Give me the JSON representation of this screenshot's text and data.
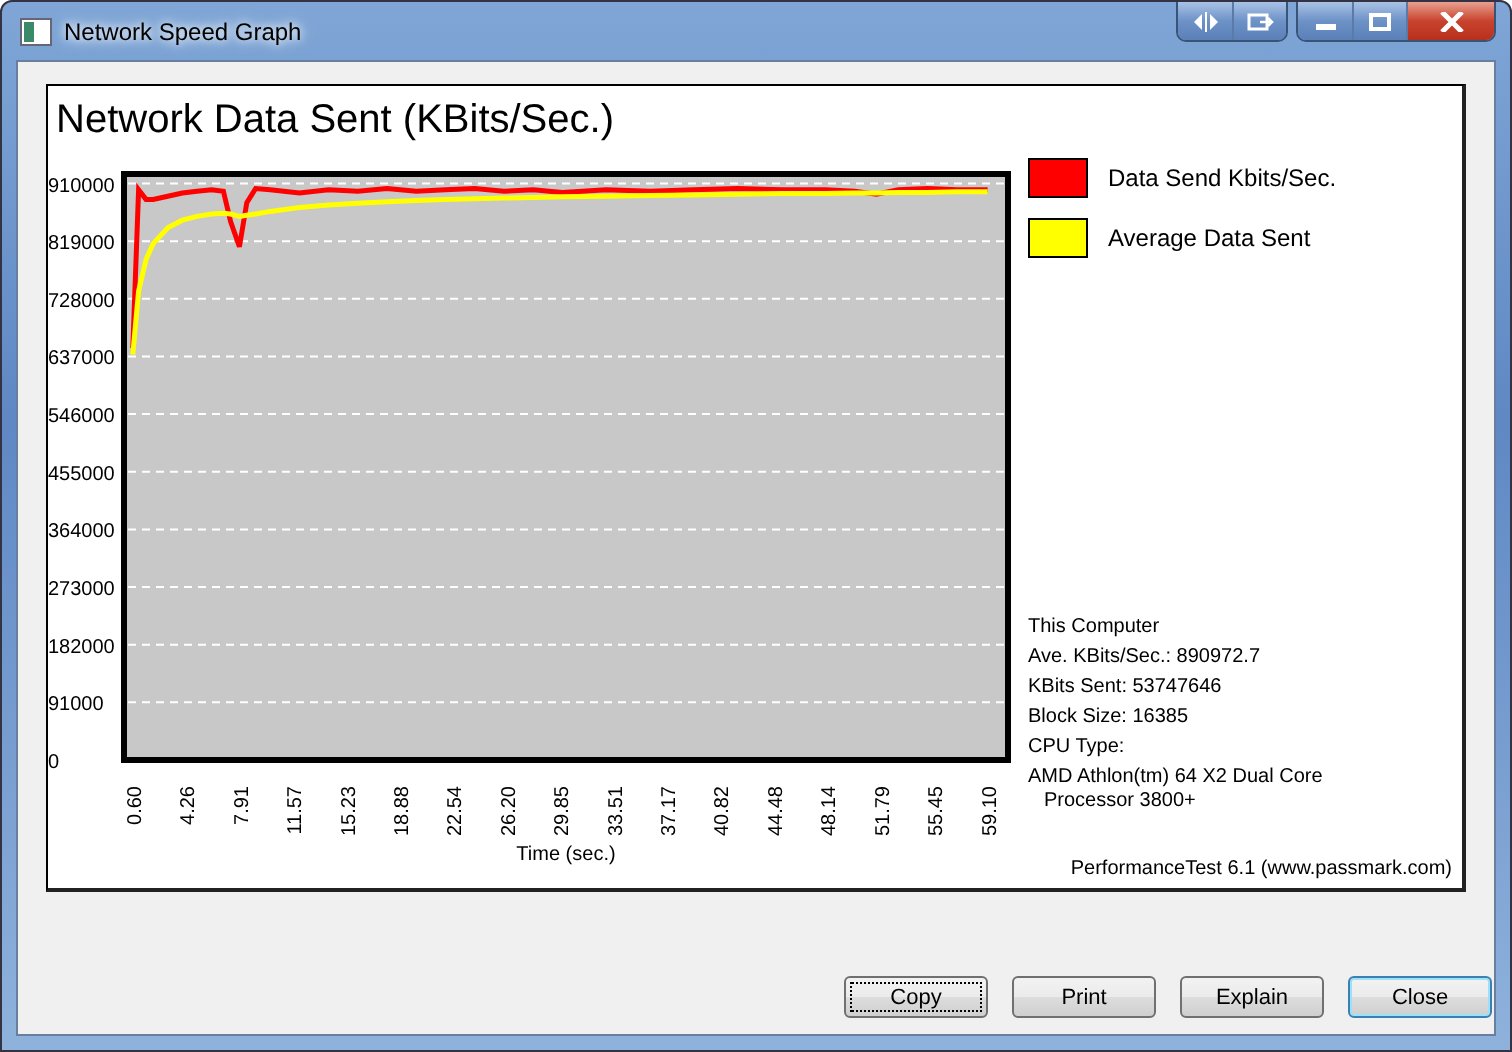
{
  "window": {
    "title": "Network Speed Graph"
  },
  "graph": {
    "title": "Network Data Sent (KBits/Sec.)",
    "chart_data": {
      "type": "line",
      "xlabel": "Time (sec.)",
      "xlim": [
        0,
        60.5
      ],
      "ylim": [
        0,
        925000
      ],
      "grid": true,
      "xticks": [
        {
          "value": 0.6,
          "label": "0.60"
        },
        {
          "value": 4.26,
          "label": "4.26"
        },
        {
          "value": 7.91,
          "label": "7.91"
        },
        {
          "value": 11.57,
          "label": "11.57"
        },
        {
          "value": 15.23,
          "label": "15.23"
        },
        {
          "value": 18.88,
          "label": "18.88"
        },
        {
          "value": 22.54,
          "label": "22.54"
        },
        {
          "value": 26.2,
          "label": "26.20"
        },
        {
          "value": 29.85,
          "label": "29.85"
        },
        {
          "value": 33.51,
          "label": "33.51"
        },
        {
          "value": 37.17,
          "label": "37.17"
        },
        {
          "value": 40.82,
          "label": "40.82"
        },
        {
          "value": 44.48,
          "label": "44.48"
        },
        {
          "value": 48.14,
          "label": "48.14"
        },
        {
          "value": 51.79,
          "label": "51.79"
        },
        {
          "value": 55.45,
          "label": "55.45"
        },
        {
          "value": 59.1,
          "label": "59.10"
        }
      ],
      "yticks": [
        0,
        91000,
        182000,
        273000,
        364000,
        455000,
        546000,
        637000,
        728000,
        819000,
        910000
      ],
      "x": [
        0.6,
        1.0,
        1.5,
        2,
        3,
        4,
        5,
        6,
        6.8,
        7.3,
        7.9,
        8.4,
        9,
        10,
        12,
        14,
        16,
        18,
        20,
        22,
        24,
        26,
        28,
        30,
        33,
        36,
        39,
        42,
        45,
        48,
        50,
        51.5,
        53,
        55,
        57,
        59.1
      ],
      "series": [
        {
          "name": "Data Send Kbits/Sec.",
          "color": "#ff0000",
          "values": [
            650000,
            900000,
            885000,
            885000,
            890000,
            895000,
            898000,
            900000,
            898000,
            850000,
            810000,
            880000,
            902000,
            900000,
            895000,
            900000,
            898000,
            902000,
            898000,
            900000,
            902000,
            898000,
            900000,
            896000,
            900000,
            898000,
            900000,
            902000,
            900000,
            900000,
            898000,
            893000,
            900000,
            902000,
            900000,
            900000
          ]
        },
        {
          "name": "Average Data Sent",
          "color": "#ffff00",
          "values": [
            640000,
            740000,
            790000,
            815000,
            840000,
            852000,
            858000,
            862000,
            863000,
            862000,
            858000,
            860000,
            862000,
            866000,
            872000,
            876000,
            879000,
            881000,
            883000,
            885000,
            886000,
            887000,
            888000,
            889000,
            890000,
            891000,
            892000,
            893000,
            894000,
            894000,
            895000,
            895000,
            896000,
            896000,
            897000,
            897000
          ]
        }
      ]
    }
  },
  "info": {
    "heading": "This Computer",
    "lines": [
      "Ave. KBits/Sec.: 890972.7",
      "KBits Sent: 53747646",
      "Block Size: 16385",
      "CPU Type:"
    ],
    "cpu_lines": [
      "AMD Athlon(tm) 64 X2 Dual Core",
      "Processor 3800+"
    ]
  },
  "footer": "PerformanceTest 6.1 (www.passmark.com)",
  "buttons": [
    {
      "label": "Copy",
      "focused": true,
      "default": false
    },
    {
      "label": "Print",
      "focused": false,
      "default": false
    },
    {
      "label": "Explain",
      "focused": false,
      "default": false
    },
    {
      "label": "Close",
      "focused": false,
      "default": true
    }
  ]
}
